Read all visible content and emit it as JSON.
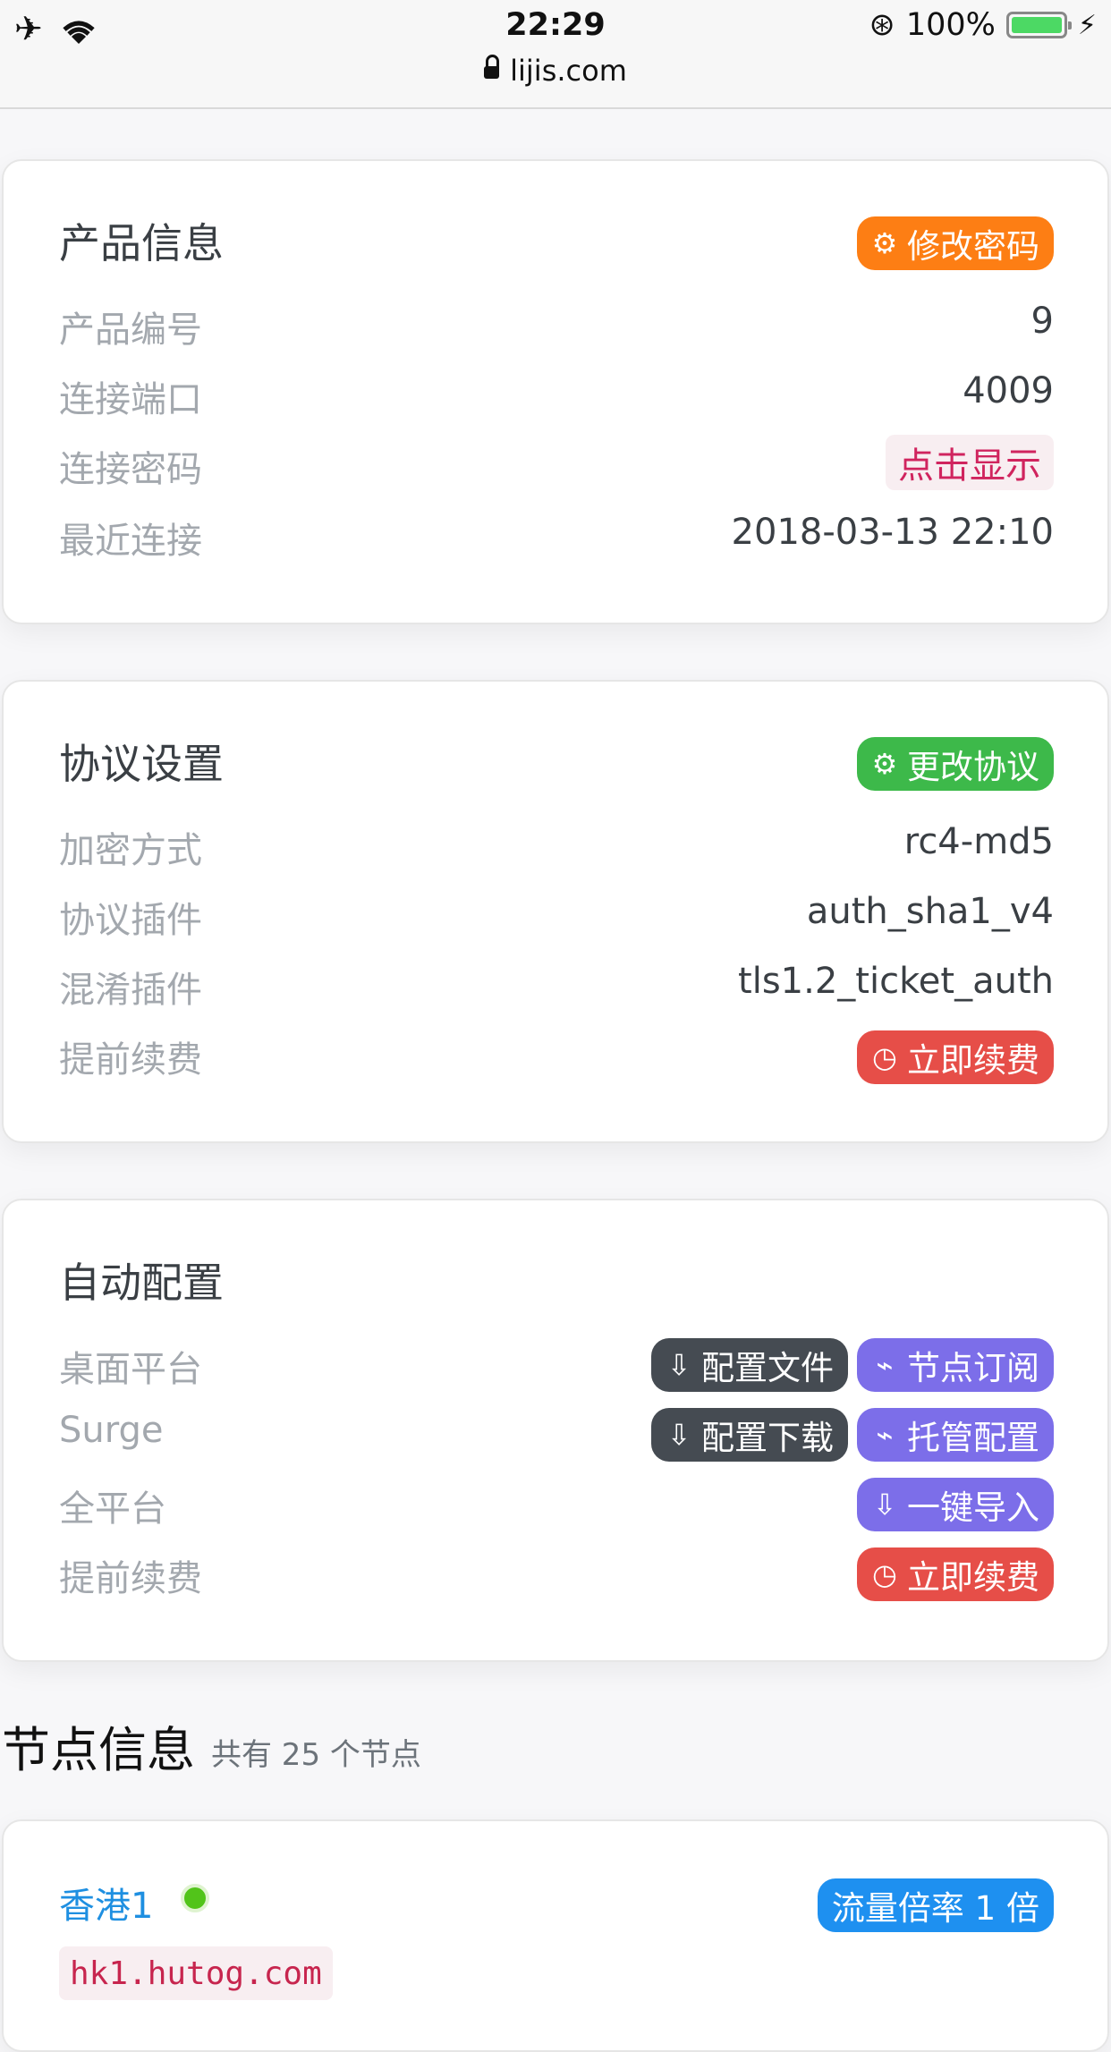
{
  "status_bar": {
    "time": "22:29",
    "url": "lijis.com",
    "battery": "100%"
  },
  "product": {
    "title": "产品信息",
    "action": "修改密码",
    "rows": [
      {
        "label": "产品编号",
        "value": "9"
      },
      {
        "label": "连接端口",
        "value": "4009"
      },
      {
        "label": "连接密码",
        "value": "点击显示"
      },
      {
        "label": "最近连接",
        "value": "2018-03-13 22:10"
      }
    ]
  },
  "protocol": {
    "title": "协议设置",
    "action": "更改协议",
    "rows": [
      {
        "label": "加密方式",
        "value": "rc4-md5"
      },
      {
        "label": "协议插件",
        "value": "auth_sha1_v4"
      },
      {
        "label": "混淆插件",
        "value": "tls1.2_ticket_auth"
      },
      {
        "label": "提前续费",
        "value": "立即续费"
      }
    ]
  },
  "auto_config": {
    "title": "自动配置",
    "rows": [
      {
        "label": "桌面平台",
        "buttons": [
          "配置文件",
          "节点订阅"
        ]
      },
      {
        "label": "Surge",
        "buttons": [
          "配置下载",
          "托管配置"
        ]
      },
      {
        "label": "全平台",
        "buttons": [
          "一键导入"
        ]
      },
      {
        "label": "提前续费",
        "buttons": [
          "立即续费"
        ]
      }
    ]
  },
  "nodes": {
    "title": "节点信息",
    "subtitle": "共有 25 个节点",
    "first": {
      "name": "香港1",
      "rate": "流量倍率 1 倍",
      "host": "hk1.hutog.com"
    }
  }
}
